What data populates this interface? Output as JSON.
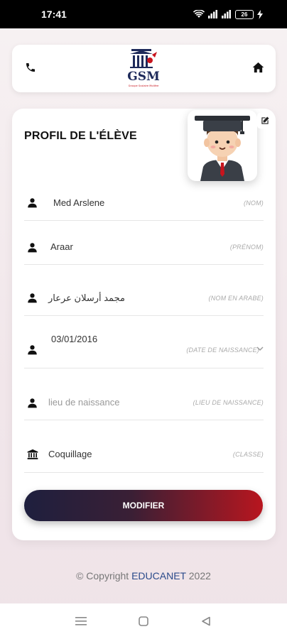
{
  "status_bar": {
    "time": "17:41",
    "battery": "26"
  },
  "header": {
    "logo_text": "GSM",
    "logo_subtext": "Groupe Scolaire Molière"
  },
  "profile": {
    "title": "PROFIL DE L'ÉLÈVE",
    "fields": [
      {
        "value": "Med Arslene",
        "label": "(NOM)",
        "icon": "user-icon"
      },
      {
        "value": "Araar",
        "label": "(PRÉNOM)",
        "icon": "user-icon"
      },
      {
        "value": "مجمد أرسلان عرعار",
        "label": "(NOM EN ARABE)",
        "icon": "user-icon"
      },
      {
        "value": "03/01/2016",
        "label": "(DATE DE NAISSANCE)",
        "icon": "user-icon"
      },
      {
        "value": "lieu de naissance",
        "label": "(LIEU DE NAISSANCE)",
        "icon": "user-icon"
      },
      {
        "value": "Coquillage",
        "label": "(CLASSE)",
        "icon": "institution-icon"
      }
    ],
    "modify_label": "MODIFIER"
  },
  "footer": {
    "copyright_prefix": "© Copyright ",
    "brand": "EDUCANET",
    "year": " 2022"
  },
  "colors": {
    "button_start": "#1e1f3e",
    "button_end": "#b8161f",
    "brand_blue": "#2a4a8a"
  }
}
